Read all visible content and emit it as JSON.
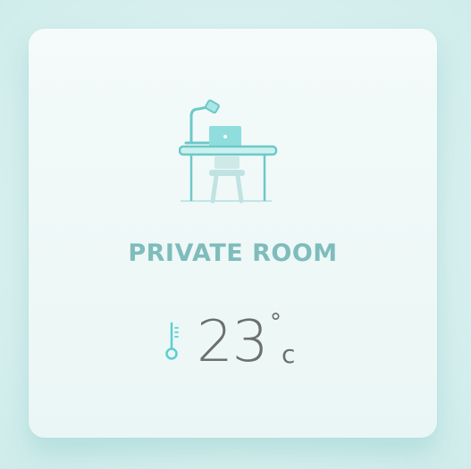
{
  "card": {
    "title": "PRIVATE ROOM",
    "temperature": {
      "value": "23",
      "degree_symbol": "°",
      "unit": "c"
    },
    "illustration_icon": "desk-with-lamp-laptop-chair-icon",
    "thermometer_icon": "thermometer-icon"
  },
  "colors": {
    "accent": "#7fd3d3",
    "title": "#7fbcbc",
    "temperature_text": "#6b6f6f",
    "card_bg": "#eef8f7"
  }
}
